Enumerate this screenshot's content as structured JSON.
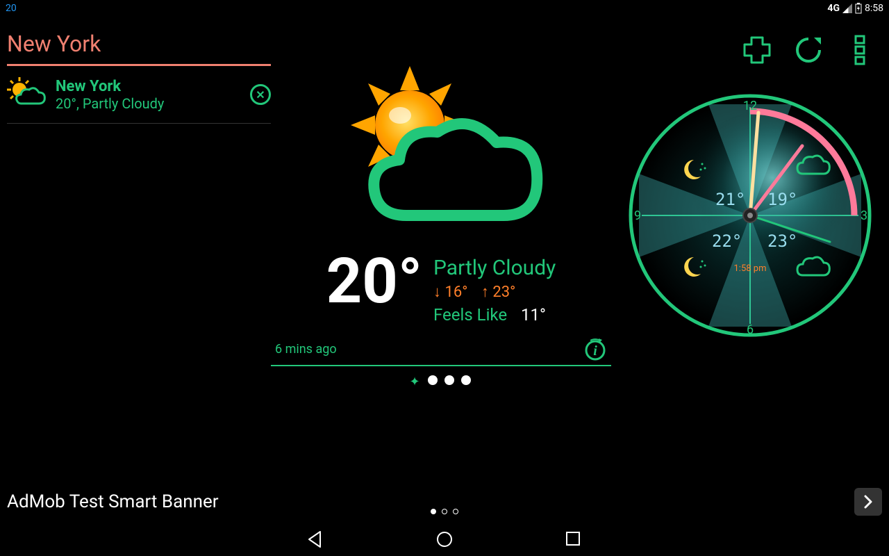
{
  "status": {
    "left": "20",
    "network": "4G",
    "time": "8:58"
  },
  "sidebar": {
    "title": "New York",
    "items": [
      {
        "name": "New York",
        "summary": "20°, Partly Cloudy"
      }
    ]
  },
  "weather": {
    "temp": "20°",
    "condition": "Partly Cloudy",
    "low_label": "↓ 16°",
    "high_label": "↑ 23°",
    "feels_label": "Feels Like",
    "feels_value": "11°",
    "updated": "6 mins ago"
  },
  "clock": {
    "hours": [
      "12",
      "3",
      "6",
      "9"
    ],
    "forecast": [
      "21°",
      "19°",
      "22°",
      "23°"
    ],
    "small_time": "1:58 pm"
  },
  "banner": {
    "text": "AdMob Test Smart Banner"
  }
}
